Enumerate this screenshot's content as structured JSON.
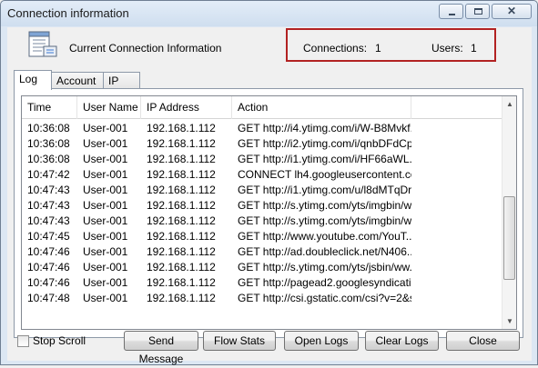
{
  "window": {
    "title": "Connection information",
    "controls": {
      "minimize": "minimize-icon",
      "maximize": "maximize-icon",
      "close": "close-icon",
      "close_glyph": "✕"
    }
  },
  "header": {
    "icon": "connection-info-icon",
    "label": "Current Connection Information",
    "connections_label": "Connections:",
    "connections_value": "1",
    "users_label": "Users:",
    "users_value": "1",
    "highlight_color": "#b22222"
  },
  "tabs": [
    {
      "label": "Log",
      "active": true
    },
    {
      "label": "Account",
      "active": false
    },
    {
      "label": "IP",
      "active": false
    }
  ],
  "log_table": {
    "columns": [
      "Time",
      "User Name",
      "IP Address",
      "Action"
    ],
    "rows": [
      [
        "10:36:08",
        "User-001",
        "192.168.1.112",
        "GET http://i4.ytimg.com/i/W-B8Mvkf..."
      ],
      [
        "10:36:08",
        "User-001",
        "192.168.1.112",
        "GET http://i2.ytimg.com/i/qnbDFdCp..."
      ],
      [
        "10:36:08",
        "User-001",
        "192.168.1.112",
        "GET http://i1.ytimg.com/i/HF66aWL..."
      ],
      [
        "10:47:42",
        "User-001",
        "192.168.1.112",
        "CONNECT lh4.googleusercontent.co..."
      ],
      [
        "10:47:43",
        "User-001",
        "192.168.1.112",
        "GET http://i1.ytimg.com/u/l8dMTqDr..."
      ],
      [
        "10:47:43",
        "User-001",
        "192.168.1.112",
        "GET http://s.ytimg.com/yts/imgbin/w..."
      ],
      [
        "10:47:43",
        "User-001",
        "192.168.1.112",
        "GET http://s.ytimg.com/yts/imgbin/w..."
      ],
      [
        "10:47:45",
        "User-001",
        "192.168.1.112",
        "GET http://www.youtube.com/YouT..."
      ],
      [
        "10:47:46",
        "User-001",
        "192.168.1.112",
        "GET http://ad.doubleclick.net/N406..."
      ],
      [
        "10:47:46",
        "User-001",
        "192.168.1.112",
        "GET http://s.ytimg.com/yts/jsbin/ww..."
      ],
      [
        "10:47:46",
        "User-001",
        "192.168.1.112",
        "GET http://pagead2.googlesyndicati..."
      ],
      [
        "10:47:48",
        "User-001",
        "192.168.1.112",
        "GET http://csi.gstatic.com/csi?v=2&s..."
      ]
    ]
  },
  "scrollbar": {
    "up": "▲",
    "down": "▼"
  },
  "footer": {
    "stop_scroll_label": "Stop Scroll",
    "stop_scroll_checked": false,
    "buttons": [
      "Send Message",
      "Flow Stats",
      "Open Logs",
      "Clear Logs",
      "Close"
    ]
  }
}
